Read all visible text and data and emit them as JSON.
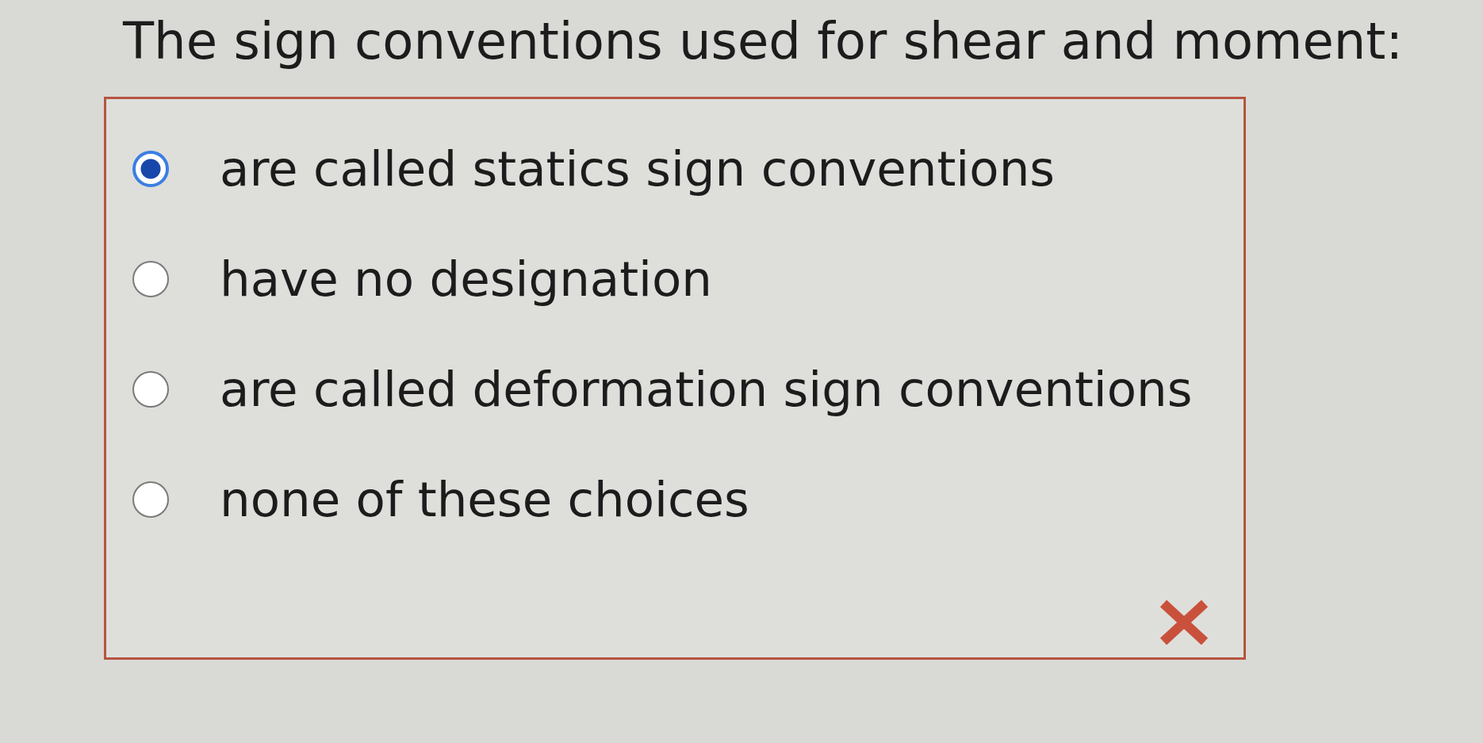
{
  "question": {
    "text": "The sign conventions used for shear and moment:"
  },
  "answer_box": {
    "options": [
      {
        "label": "are called statics sign conventions",
        "selected": true
      },
      {
        "label": "have no designation",
        "selected": false
      },
      {
        "label": "are called deformation sign conventions",
        "selected": false
      },
      {
        "label": "none of these choices",
        "selected": false
      }
    ],
    "result": {
      "kind": "incorrect"
    }
  }
}
